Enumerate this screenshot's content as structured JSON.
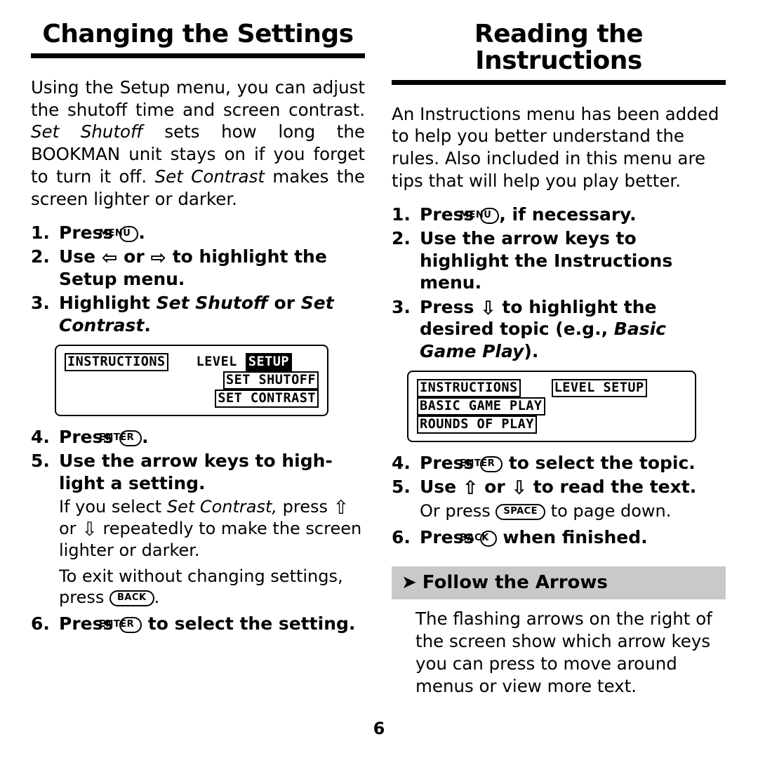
{
  "page": {
    "number": "6"
  },
  "left": {
    "title": "Changing the Settings",
    "intro_html": "Using the Setup menu, you can adjust the shutoff time and screen contrast. <i>Set Shutoff</i> sets how long the BOOKMAN unit stays on if you forget to turn it off. <i>Set Contrast</i> makes the screen lighter or darker.",
    "steps": [
      {
        "num": "1.",
        "html": "Press <span class=\"key\">MENU</span>."
      },
      {
        "num": "2.",
        "html": "Use <span class=\"arrow-glyph\">⇦</span> or <span class=\"arrow-glyph\">⇨</span> to highlight the Setup menu."
      },
      {
        "num": "3.",
        "html": "Highlight <i>Set Shutoff</i> or <i>Set Contrast</i>."
      }
    ],
    "lcd": {
      "line1_left": "INSTRUCTIONS",
      "line1_mid": "LEVEL",
      "line1_right": "SETUP",
      "line2": "SET SHUTOFF",
      "line3": "SET CONTRAST"
    },
    "steps2": [
      {
        "num": "4.",
        "html": "Press <span class=\"key\">ENTER</span>."
      },
      {
        "num": "5.",
        "html": "Use the arrow keys to high-light a setting."
      }
    ],
    "sub1_html": "If you select <i>Set Contrast,</i> press <span class=\"arrow-glyph\">⇧</span> or <span class=\"arrow-glyph\">⇩</span> repeatedly to make the screen lighter or darker.",
    "sub2_html": "To exit without changing settings, press <span class=\"key\">BACK</span>.",
    "steps3": [
      {
        "num": "6.",
        "html": "Press <span class=\"key\">ENTER</span> to select the setting."
      }
    ]
  },
  "right": {
    "title": "Reading the Instructions",
    "intro_html": "An Instructions menu has been added to help you better understand the rules. Also included in this menu are tips that will help you play better.",
    "steps": [
      {
        "num": "1.",
        "html": "Press <span class=\"key\">MENU</span>, if necessary."
      },
      {
        "num": "2.",
        "html": "Use the arrow keys to highlight the Instructions menu."
      },
      {
        "num": "3.",
        "html": "Press <span class=\"arrow-glyph\">⇩</span> to highlight the desired topic (e.g., <i>Basic Game Play</i>)."
      }
    ],
    "lcd": {
      "line1_left": "INSTRUCTIONS",
      "line1_right": "LEVEL SETUP",
      "line2": "BASIC GAME PLAY",
      "line3": "ROUNDS OF PLAY"
    },
    "steps2": [
      {
        "num": "4.",
        "html": "Press <span class=\"key\">ENTER</span> to select the topic."
      },
      {
        "num": "5.",
        "html": "Use <span class=\"arrow-glyph\">⇧</span> or <span class=\"arrow-glyph\">⇩</span> to read the text."
      }
    ],
    "sub1_html": "Or press <span class=\"key\">SPACE</span> to page down.",
    "steps3": [
      {
        "num": "6.",
        "html": "Press <span class=\"key\">BACK</span> when finished."
      }
    ],
    "section": {
      "arrow": "➤",
      "title": "Follow the Arrows",
      "body": "The flashing arrows on the right of the screen show which arrow keys you can press to move around menus or view more text."
    }
  }
}
